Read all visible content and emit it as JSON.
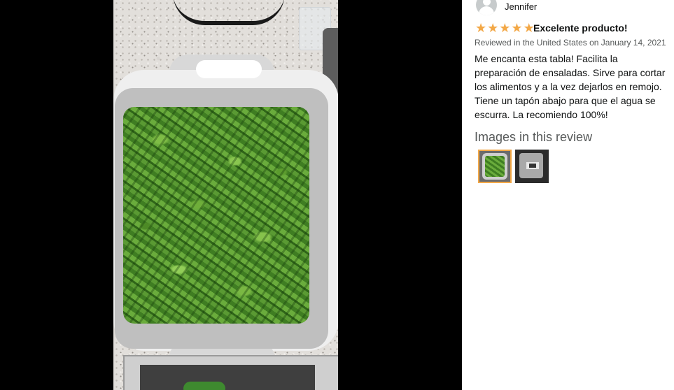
{
  "review": {
    "reviewer_name": "Jennifer",
    "rating_stars": 5,
    "headline": "Excelente producto!",
    "meta": "Reviewed in the United States on January 14, 2021",
    "body": "Me encanta esta tabla! Facilita la preparación de ensaladas. Sirve para cortar los alimentos y a la vez dejarlos en remojo. Tiene un tapón abajo para que el agua se escurra. La recomiendo 100%!"
  },
  "images_section": {
    "heading": "Images in this review",
    "selected_index": 0
  },
  "colors": {
    "star": "#f3a847",
    "selected_border": "#f3a847",
    "viewer_bg": "#000000",
    "panel_bg": "#ffffff"
  },
  "icons": [
    "star-icon",
    "avatar-icon"
  ]
}
